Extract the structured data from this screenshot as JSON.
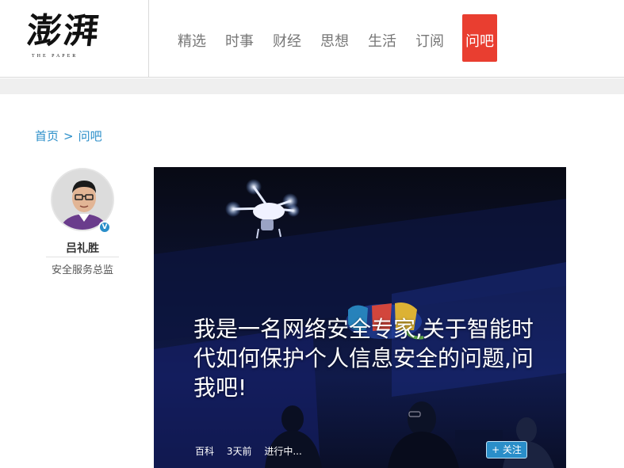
{
  "logo": {
    "text": "澎湃",
    "subtitle": "THE PAPER"
  },
  "nav": [
    {
      "label": "精选"
    },
    {
      "label": "时事"
    },
    {
      "label": "财经"
    },
    {
      "label": "思想"
    },
    {
      "label": "生活"
    },
    {
      "label": "订阅"
    },
    {
      "label": "问吧",
      "active": true
    }
  ],
  "breadcrumb": {
    "home": "首页",
    "separator": ">",
    "current": "问吧"
  },
  "author": {
    "name": "吕礼胜",
    "title": "安全服务总监",
    "verified_badge": "V"
  },
  "hero": {
    "title": "我是一名网络安全专家,关于智能时代如何保护个人信息安全的问题,问我吧!",
    "category": "百科",
    "time": "3天前",
    "status": "进行中...",
    "follow_label": "+ 关注"
  },
  "colors": {
    "accent_red": "#e93e30",
    "link_blue": "#2a8ec9",
    "follow_blue": "#2a8ec9"
  },
  "icons": {
    "verified": "verified-badge-icon"
  }
}
